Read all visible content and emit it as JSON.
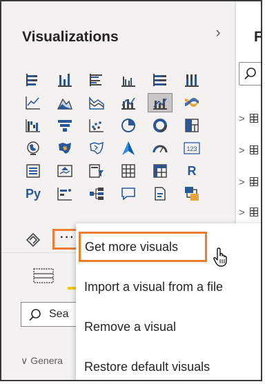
{
  "visualizations_pane": {
    "title": "Visualizations",
    "collapse_glyph": "›",
    "search_placeholder": "Sea",
    "general_label": "Genera"
  },
  "fields_pane": {
    "title": "Fie"
  },
  "viz_icons": [
    "stacked-bar-chart-icon",
    "stacked-column-chart-icon",
    "clustered-bar-chart-icon",
    "clustered-column-chart-icon",
    "100-stacked-bar-chart-icon",
    "100-stacked-column-chart-icon",
    "line-chart-icon",
    "area-chart-icon",
    "stacked-area-chart-icon",
    "line-and-stacked-column-chart-icon",
    "line-and-clustered-column-chart-icon",
    "ribbon-chart-icon",
    "waterfall-chart-icon",
    "funnel-chart-icon",
    "scatter-chart-icon",
    "pie-chart-icon",
    "donut-chart-icon",
    "treemap-icon",
    "map-icon",
    "filled-map-icon",
    "shape-map-icon",
    "azure-map-icon",
    "gauge-icon",
    "card-icon",
    "multi-row-card-icon",
    "kpi-icon",
    "slicer-icon",
    "table-icon",
    "matrix-icon",
    "r-script-visual-icon",
    "python-visual-icon",
    "key-influencers-icon",
    "decomposition-tree-icon",
    "qa-icon",
    "smart-narrative-icon",
    "paginated-report-icon"
  ],
  "bottom_row": {
    "extra_icon": "power-apps-icon",
    "more_button_label": "···"
  },
  "context_menu": {
    "items": [
      "Get more visuals",
      "Import a visual from a file",
      "Remove a visual",
      "Restore default visuals"
    ]
  },
  "colors": {
    "accent_orange": "#ed7d31",
    "tab_yellow": "#f2c811",
    "pane_bg": "#f3f2f1",
    "icon_blue": "#2b5797"
  },
  "r_label": "R",
  "py_label": "Py",
  "card_label": "123"
}
